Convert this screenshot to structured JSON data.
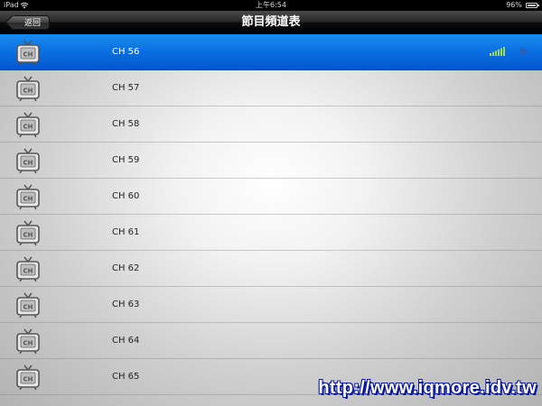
{
  "status_bar": {
    "carrier": "iPad",
    "time": "上午6:54",
    "battery": "96%"
  },
  "nav": {
    "title": "節目頻道表",
    "back_label": "返回"
  },
  "channels": [
    {
      "label": "CH 56",
      "selected": true,
      "icon": "tv-icon"
    },
    {
      "label": "CH 57",
      "selected": false,
      "icon": "tv-icon"
    },
    {
      "label": "CH 58",
      "selected": false,
      "icon": "tv-icon"
    },
    {
      "label": "CH 59",
      "selected": false,
      "icon": "tv-icon"
    },
    {
      "label": "CH 60",
      "selected": false,
      "icon": "tv-icon"
    },
    {
      "label": "CH 61",
      "selected": false,
      "icon": "tv-icon"
    },
    {
      "label": "CH 62",
      "selected": false,
      "icon": "tv-icon"
    },
    {
      "label": "CH 63",
      "selected": false,
      "icon": "tv-icon"
    },
    {
      "label": "CH 64",
      "selected": false,
      "icon": "tv-icon"
    },
    {
      "label": "CH 65",
      "selected": false,
      "icon": "tv-icon"
    }
  ],
  "selected_row_icons": [
    "signal-strength-icon",
    "play-icon"
  ],
  "watermark": "http://www.iqmore.idv.tw",
  "colors": {
    "selected_row": "#0a6fe0",
    "signal_bars": "#9fe04a",
    "play": "#2a5fb8"
  }
}
